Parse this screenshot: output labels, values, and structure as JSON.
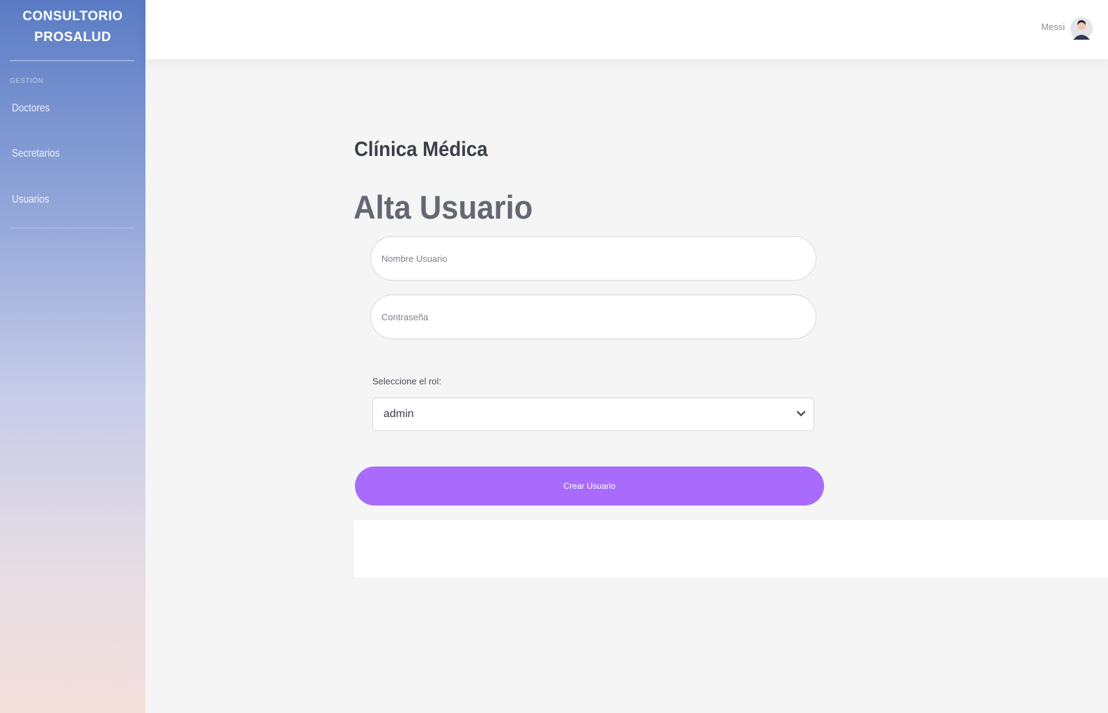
{
  "sidebar": {
    "brand_line1": "CONSULTORIO",
    "brand_line2": "PROSALUD",
    "section": "GESTIÓN",
    "items": [
      {
        "label": "Doctores"
      },
      {
        "label": "Secretarios"
      },
      {
        "label": "Usuarios"
      }
    ]
  },
  "header": {
    "user_name": "Messi",
    "avatar_icon": "user-avatar-icon"
  },
  "main": {
    "subtitle": "Clínica Médica",
    "title": "Alta Usuario",
    "username_placeholder": "Nombre Usuario",
    "password_placeholder": "Contraseña",
    "role_label": "Seleccione el rol:",
    "role_selected": "admin",
    "submit_label": "Crear Usuario"
  },
  "colors": {
    "accent": "#a86bfb",
    "sidebar_top": "#5a7bc4",
    "sidebar_bottom": "#f3e0dc"
  }
}
